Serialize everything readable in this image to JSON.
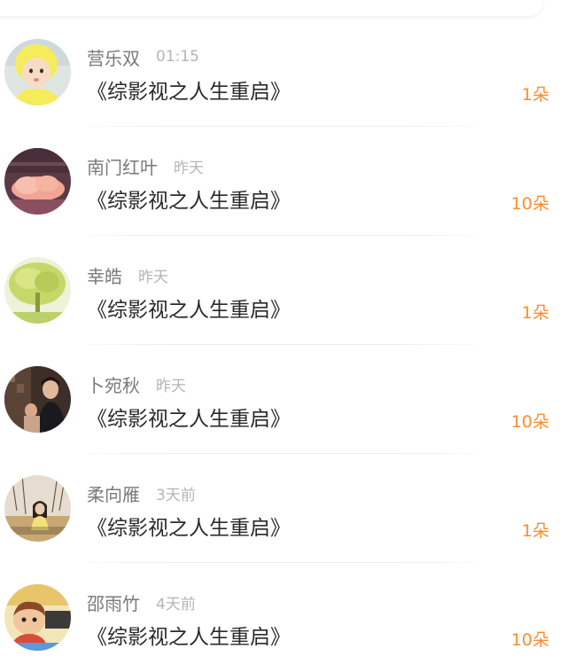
{
  "colors": {
    "name": "#7a7a7a",
    "time": "#b5b5b5",
    "title": "#2a2a2a",
    "gift": "#ff8c2e",
    "divider": "#ededed"
  },
  "list": {
    "items": [
      {
        "name": "营乐双",
        "time": "01:15",
        "title": "《综影视之人生重启》",
        "gift": "1朵",
        "avatar_icon": "child-yellow-hat-avatar"
      },
      {
        "name": "南门红叶",
        "time": "昨天",
        "title": "《综影视之人生重启》",
        "gift": "10朵",
        "avatar_icon": "pink-cloud-avatar"
      },
      {
        "name": "幸皓",
        "time": "昨天",
        "title": "《综影视之人生重启》",
        "gift": "1朵",
        "avatar_icon": "green-tree-avatar"
      },
      {
        "name": "卜宛秋",
        "time": "昨天",
        "title": "《综影视之人生重启》",
        "gift": "10朵",
        "avatar_icon": "couple-photo-avatar"
      },
      {
        "name": "柔向雁",
        "time": "3天前",
        "title": "《综影视之人生重启》",
        "gift": "1朵",
        "avatar_icon": "girl-field-avatar"
      },
      {
        "name": "邵雨竹",
        "time": "4天前",
        "title": "《综影视之人生重启》",
        "gift": "10朵",
        "avatar_icon": "cartoon-character-avatar"
      }
    ]
  }
}
